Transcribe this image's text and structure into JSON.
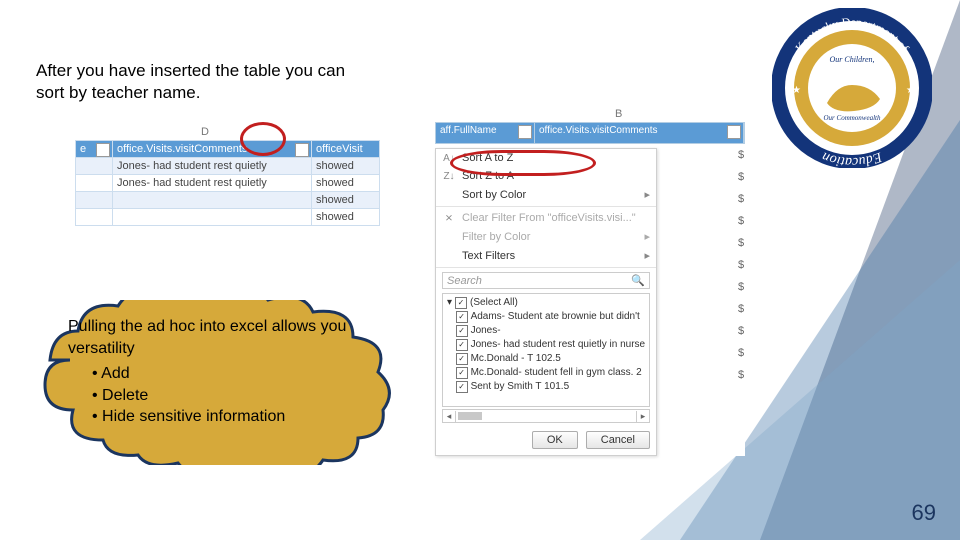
{
  "intro": "After you have inserted the table you can sort by teacher name.",
  "page_number": "69",
  "left_shot": {
    "col_letter": "D",
    "headers": [
      "e",
      "office.Visits.visitComments",
      "officeVisit"
    ],
    "rows": [
      [
        "",
        "Jones- had student rest quietly",
        "showed"
      ],
      [
        "",
        "Jones- had student rest quietly",
        "showed"
      ],
      [
        "",
        "",
        "showed"
      ],
      [
        "",
        "",
        "showed"
      ]
    ]
  },
  "right_shot": {
    "col_letter": "B",
    "headers": [
      "aff.FullName",
      "office.Visits.visitComments"
    ],
    "menu": {
      "sort_az": "Sort A to Z",
      "sort_za": "Sort Z to A",
      "sort_color": "Sort by Color",
      "clear_filter": "Clear Filter From \"officeVisits.visi...\"",
      "filter_color": "Filter by Color",
      "text_filters": "Text Filters",
      "search_placeholder": "Search",
      "tree": [
        "(Select All)",
        "Adams- Student ate brownie but didn't",
        "Jones-",
        "Jones- had student rest quietly in nurse",
        "Mc.Donald - T 102.5",
        "Mc.Donald- student fell in gym class. 2",
        "Sent by Smith   T 101.5"
      ],
      "ok": "OK",
      "cancel": "Cancel"
    }
  },
  "cloud": {
    "lead": "Pulling the ad hoc into excel allows you versatility",
    "items": [
      "Add",
      "Delete",
      "Hide sensitive information"
    ]
  },
  "logo": {
    "outer_top": "Kentucky Department of",
    "outer_bottom": "Education",
    "inner_top": "Our Children,",
    "inner_bottom": "Our Commonwealth"
  }
}
